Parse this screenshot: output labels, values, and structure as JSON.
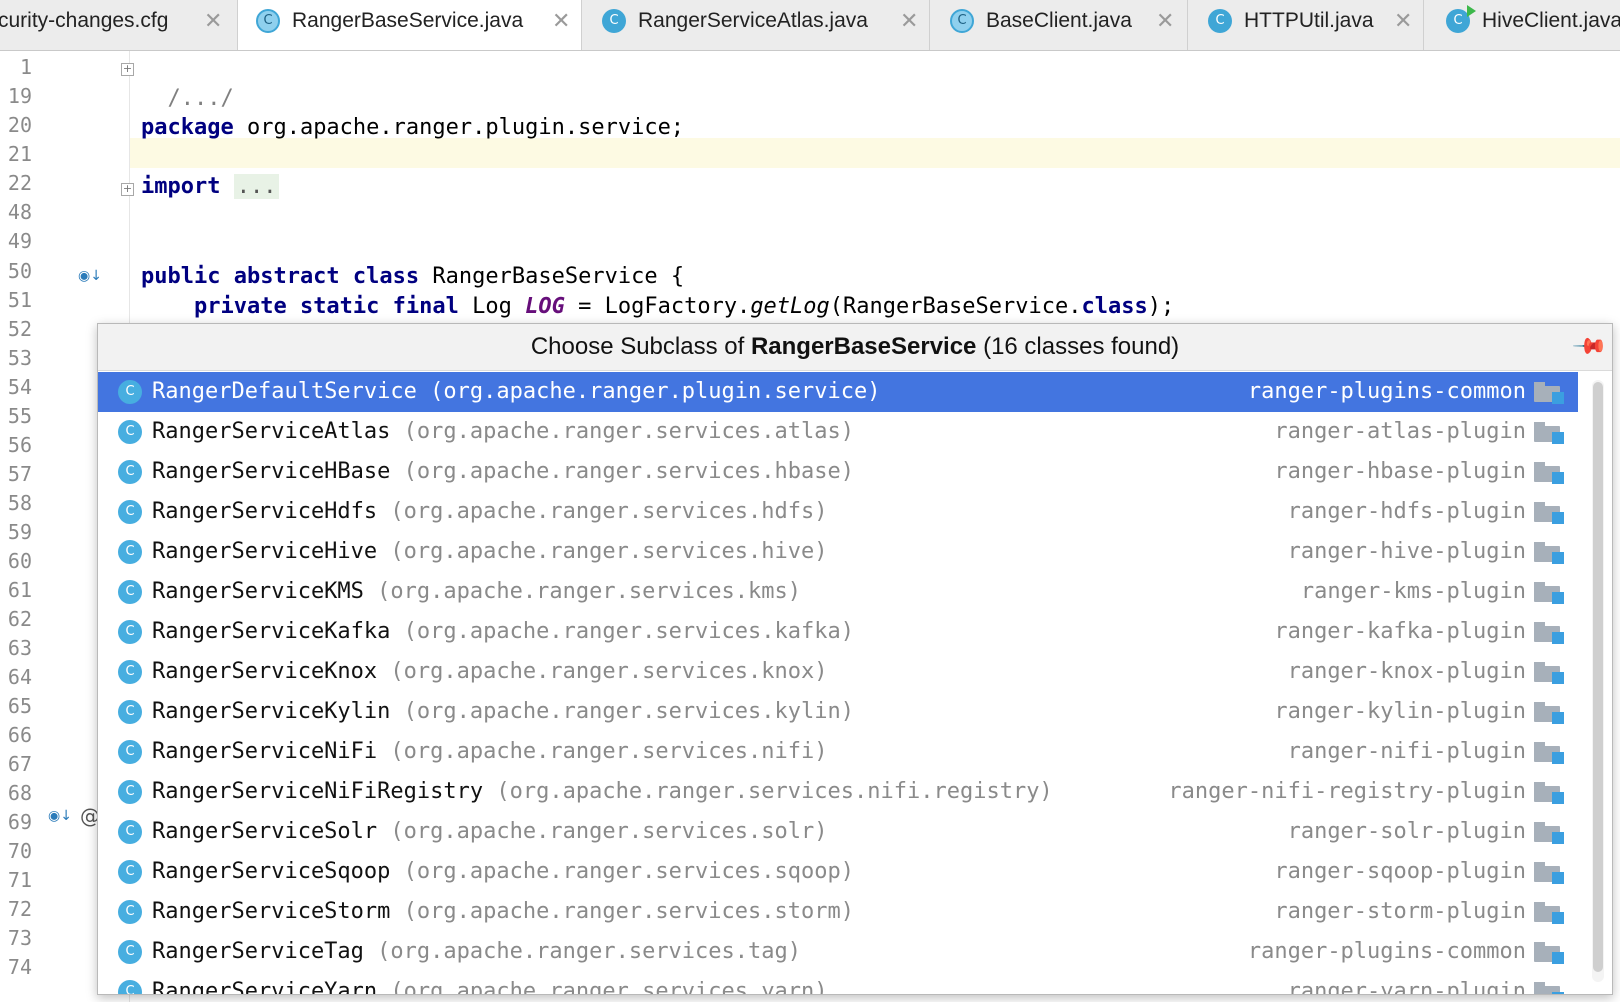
{
  "tabs": [
    {
      "label": "curity-changes.cfg",
      "icon": "config-file-icon",
      "active": false
    },
    {
      "label": "RangerBaseService.java",
      "icon": "abstract-class-icon",
      "active": true
    },
    {
      "label": "RangerServiceAtlas.java",
      "icon": "class-icon",
      "active": false
    },
    {
      "label": "BaseClient.java",
      "icon": "abstract-class-icon",
      "active": false
    },
    {
      "label": "HTTPUtil.java",
      "icon": "class-icon",
      "active": false
    },
    {
      "label": "HiveClient.java",
      "icon": "runnable-class-icon",
      "active": false
    }
  ],
  "editor": {
    "line_numbers": [
      "1",
      "19",
      "20",
      "21",
      "22",
      "48",
      "49",
      "50",
      "51",
      "52",
      "53",
      "54",
      "55",
      "56",
      "57",
      "58",
      "59",
      "60",
      "61",
      "62",
      "63",
      "64",
      "65",
      "66",
      "67",
      "68",
      "69",
      "70",
      "71",
      "72",
      "73",
      "74"
    ],
    "code": {
      "l1": "/.../",
      "l20_kw": "package",
      "l20_rest": " org.apache.ranger.plugin.service;",
      "l22_kw": "import",
      "l22_rest": "...",
      "l50_kw": "public abstract class",
      "l50_rest": " RangerBaseService {",
      "l51_kw": "private static final",
      "l51_type": " Log ",
      "l51_field": "LOG",
      "l51_mid": " = LogFactory.",
      "l51_method": "getLog",
      "l51_arg": "(RangerBaseService.",
      "l51_class": "class",
      "l51_end": ");"
    },
    "gutter_annotation": "@"
  },
  "popup": {
    "title_prefix": "Choose Subclass of ",
    "title_class": "RangerBaseService",
    "title_suffix": " (16 classes found)",
    "items": [
      {
        "name": "RangerDefaultService",
        "package": " (org.apache.ranger.plugin.service)",
        "module": "ranger-plugins-common",
        "selected": true
      },
      {
        "name": "RangerServiceAtlas",
        "package": " (org.apache.ranger.services.atlas)",
        "module": "ranger-atlas-plugin"
      },
      {
        "name": "RangerServiceHBase",
        "package": " (org.apache.ranger.services.hbase)",
        "module": "ranger-hbase-plugin"
      },
      {
        "name": "RangerServiceHdfs",
        "package": " (org.apache.ranger.services.hdfs)",
        "module": "ranger-hdfs-plugin"
      },
      {
        "name": "RangerServiceHive",
        "package": " (org.apache.ranger.services.hive)",
        "module": "ranger-hive-plugin"
      },
      {
        "name": "RangerServiceKMS",
        "package": " (org.apache.ranger.services.kms)",
        "module": "ranger-kms-plugin"
      },
      {
        "name": "RangerServiceKafka",
        "package": " (org.apache.ranger.services.kafka)",
        "module": "ranger-kafka-plugin"
      },
      {
        "name": "RangerServiceKnox",
        "package": " (org.apache.ranger.services.knox)",
        "module": "ranger-knox-plugin"
      },
      {
        "name": "RangerServiceKylin",
        "package": " (org.apache.ranger.services.kylin)",
        "module": "ranger-kylin-plugin"
      },
      {
        "name": "RangerServiceNiFi",
        "package": " (org.apache.ranger.services.nifi)",
        "module": "ranger-nifi-plugin"
      },
      {
        "name": "RangerServiceNiFiRegistry",
        "package": " (org.apache.ranger.services.nifi.registry)",
        "module": "ranger-nifi-registry-plugin"
      },
      {
        "name": "RangerServiceSolr",
        "package": " (org.apache.ranger.services.solr)",
        "module": "ranger-solr-plugin"
      },
      {
        "name": "RangerServiceSqoop",
        "package": " (org.apache.ranger.services.sqoop)",
        "module": "ranger-sqoop-plugin"
      },
      {
        "name": "RangerServiceStorm",
        "package": " (org.apache.ranger.services.storm)",
        "module": "ranger-storm-plugin"
      },
      {
        "name": "RangerServiceTag",
        "package": " (org.apache.ranger.services.tag)",
        "module": "ranger-plugins-common"
      },
      {
        "name": "RangerServiceYarn",
        "package": " (org.apache.ranger.services.yarn)",
        "module": "ranger-yarn-plugin"
      }
    ],
    "colors": {
      "selection": "#4375e0",
      "class_icon": "#47aee0",
      "folder_square": "#3b9fe0"
    }
  }
}
